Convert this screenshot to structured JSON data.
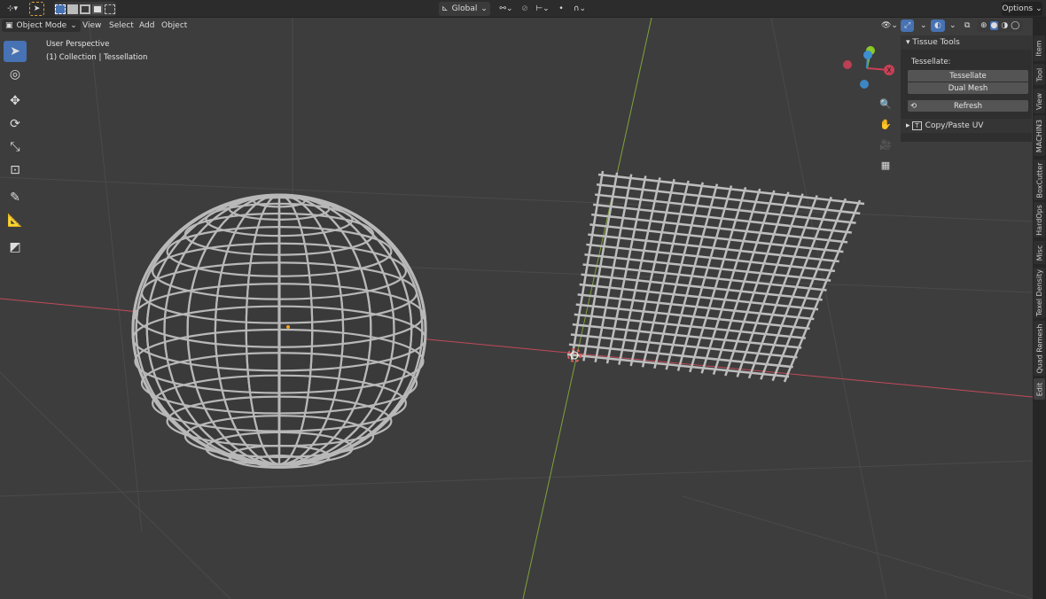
{
  "topbar": {
    "global_label": "Global",
    "options_label": "Options"
  },
  "header": {
    "mode": "Object Mode",
    "menus": [
      "View",
      "Select",
      "Add",
      "Object"
    ]
  },
  "overlay": {
    "view_name": "User Perspective",
    "collection": "(1) Collection | Tessellation"
  },
  "gizmo": {
    "x_label": "X"
  },
  "panel": {
    "title": "Tissue Tools",
    "section_label": "Tessellate:",
    "buttons": [
      "Tessellate",
      "Dual Mesh"
    ],
    "refresh_label": "Refresh",
    "subpanel": "Copy/Paste UV"
  },
  "tabs": [
    "Item",
    "Tool",
    "View",
    "MACHIN3",
    "BoxCutter",
    "HardOps",
    "Misc",
    "Texel Density",
    "Quad Remesh",
    "Edit"
  ],
  "colors": {
    "x_axis": "#c24a5a",
    "y_axis": "#7fa33a",
    "accent": "#4772b3"
  }
}
